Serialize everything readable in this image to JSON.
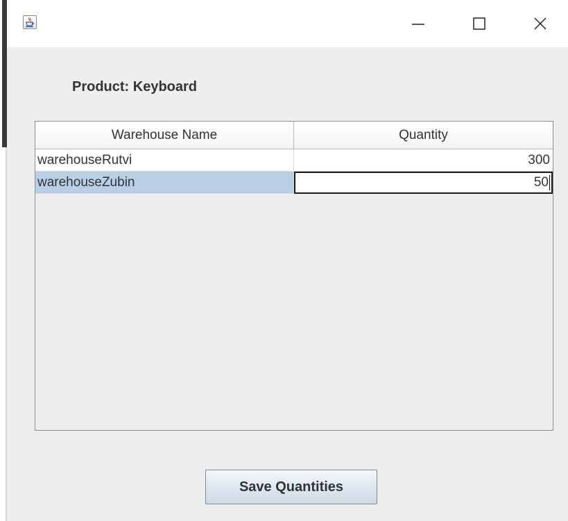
{
  "window": {
    "icons": {
      "app": "java-cup-icon",
      "minimize": "minimize-icon",
      "maximize": "maximize-icon",
      "close": "close-icon"
    }
  },
  "product_label": "Product: Keyboard",
  "table": {
    "columns": [
      "Warehouse Name",
      "Quantity"
    ],
    "rows": [
      {
        "name": "warehouseRutvi",
        "quantity": "300"
      },
      {
        "name": "warehouseZubin",
        "quantity": "50"
      }
    ],
    "selection_color": "#b8cfe5"
  },
  "actions": {
    "save_label": "Save Quantities"
  }
}
